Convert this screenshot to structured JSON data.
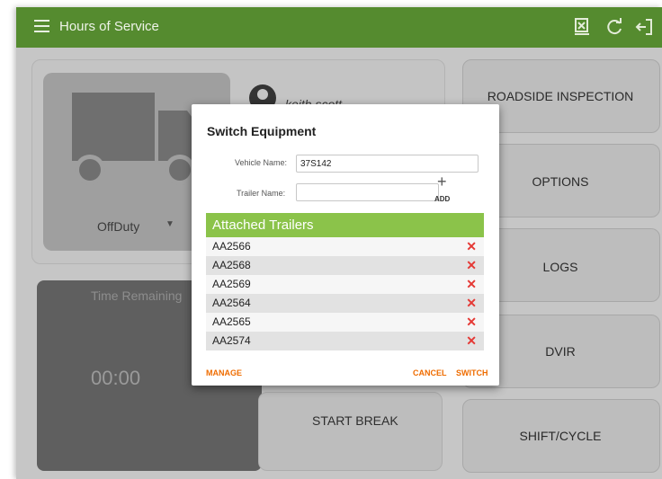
{
  "app": {
    "title": "Hours of Service"
  },
  "status": {
    "duty_status": "OffDuty",
    "driver_name": "keith scott"
  },
  "time": {
    "label": "Time Remaining",
    "value": "00:00"
  },
  "buttons": {
    "roadside": "ROADSIDE INSPECTION",
    "options": "OPTIONS",
    "logs": "LOGS",
    "dvir": "DVIR",
    "shift_cycle": "SHIFT/CYCLE",
    "start_break": "START BREAK"
  },
  "dialog": {
    "title": "Switch Equipment",
    "vehicle_label": "Vehicle Name:",
    "vehicle_value": "37S142",
    "trailer_label": "Trailer Name:",
    "trailer_value": "",
    "add_label": "ADD",
    "attached_header": "Attached Trailers",
    "trailers": [
      "AA2566",
      "AA2568",
      "AA2569",
      "AA2564",
      "AA2565",
      "AA2574"
    ],
    "manage_label": "MANAGE",
    "cancel_label": "CANCEL",
    "switch_label": "SWITCH"
  },
  "icons": {
    "menu": "menu-icon",
    "export": "export-icon",
    "refresh": "refresh-icon",
    "logout": "logout-icon",
    "remove": "close-x-icon"
  },
  "colors": {
    "app_bar": "#558b2f",
    "header_green": "#8bc34a",
    "accent_orange": "#ef6c00",
    "remove_red": "#e53935"
  }
}
